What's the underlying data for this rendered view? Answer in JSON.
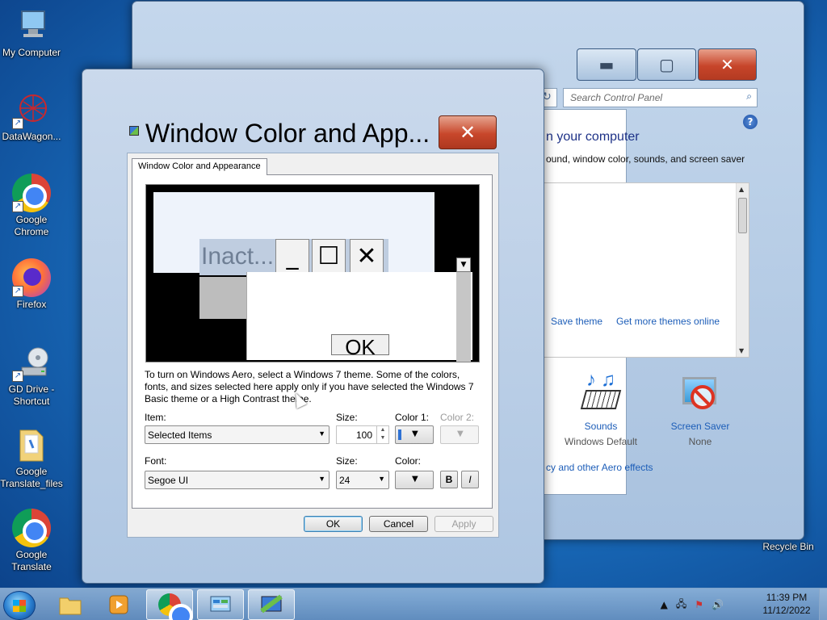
{
  "desktop": {
    "icons": [
      {
        "label": "My Computer"
      },
      {
        "label": "DataWagon..."
      },
      {
        "label": "Google Chrome"
      },
      {
        "label": "Firefox"
      },
      {
        "label": "GD Drive - Shortcut"
      },
      {
        "label": "Google Translate_files"
      },
      {
        "label": "Google Translate"
      },
      {
        "label": "Recycle Bin"
      }
    ]
  },
  "control_panel": {
    "search_placeholder": "Search Control Panel",
    "heading": "n your computer",
    "subtext": "ound, window color, sounds, and screen saver",
    "links": {
      "save_theme": "Save theme",
      "get_more_themes": "Get more themes online",
      "aero_effects": "cy and other Aero effects"
    },
    "bottom_items": [
      {
        "title": "Sounds",
        "sub": "Windows Default"
      },
      {
        "title": "Screen Saver",
        "sub": "None"
      }
    ],
    "caption_glyphs": {
      "min": "▬",
      "max": "▢",
      "close": "✕"
    }
  },
  "dialog": {
    "title": "Window Color and App...",
    "close_glyph": "✕",
    "tab_label": "Window Color and Appearance",
    "preview": {
      "inactive_title": "Inact...",
      "min_glyph": "_",
      "max_glyph": "☐",
      "close_glyph": "✕",
      "ok_label": "OK"
    },
    "info_text": "To turn on Windows Aero, select a Windows 7 theme.  Some of the colors, fonts, and sizes selected here apply only if you have selected the Windows 7 Basic theme or a High Contrast theme.",
    "item_label": "Item:",
    "item_value": "Selected Items",
    "size_label": "Size:",
    "size_value": "100",
    "color1_label": "Color 1:",
    "color2_label": "Color 2:",
    "font_label": "Font:",
    "font_value": "Segoe UI",
    "font_size_label": "Size:",
    "font_size_value": "24",
    "color_label": "Color:",
    "bold_label": "B",
    "italic_label": "I",
    "ok_button": "OK",
    "cancel_button": "Cancel",
    "apply_button": "Apply"
  },
  "taskbar": {
    "time": "11:39 PM",
    "date": "11/12/2022"
  },
  "colors": {
    "selected_color_swatch": "#2f72d4",
    "link_blue": "#1c5db8",
    "heading_blue": "#1e3287",
    "close_red": "#c8472b"
  }
}
